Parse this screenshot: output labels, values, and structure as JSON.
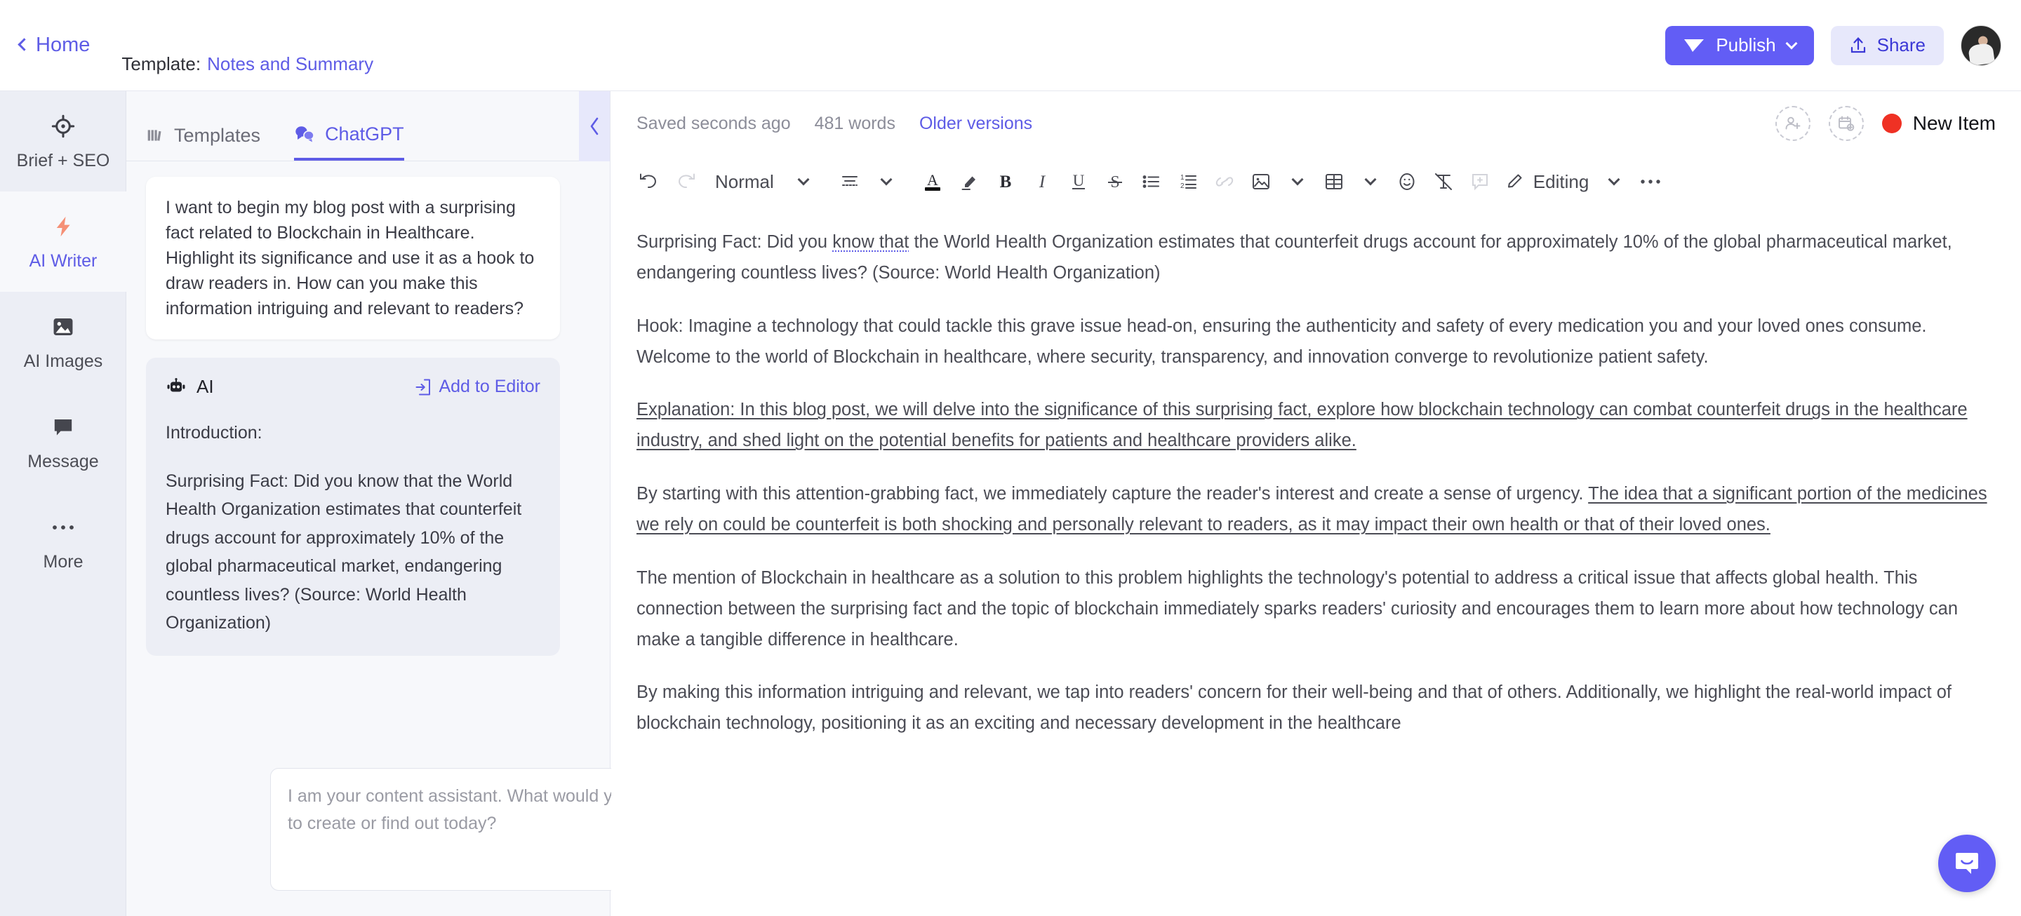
{
  "topbar": {
    "home_label": "Home",
    "template_prefix": "Template:",
    "template_name": "Notes and Summary",
    "publish_label": "Publish",
    "share_label": "Share",
    "accent_color": "#625df5"
  },
  "rail": {
    "items": [
      {
        "label": "Brief + SEO",
        "icon": "target-icon",
        "active": false
      },
      {
        "label": "AI Writer",
        "icon": "lightning-bolt-icon",
        "active": true
      },
      {
        "label": "AI Images",
        "icon": "image-icon",
        "active": false
      },
      {
        "label": "Message",
        "icon": "speech-bubble-icon",
        "active": false
      },
      {
        "label": "More",
        "icon": "ellipsis-icon",
        "active": false
      }
    ]
  },
  "panel": {
    "tabs": [
      {
        "label": "Templates",
        "icon": "templates-icon",
        "active": false
      },
      {
        "label": "ChatGPT",
        "icon": "chat-bubbles-icon",
        "active": true
      }
    ],
    "collapse_icon": "chevron-left-icon",
    "user_message": "I want to begin my blog post with a surprising fact related to Blockchain in Healthcare. Highlight its significance and use it as a hook to draw readers in. How can you make this information intriguing and relevant to readers?",
    "ai_card": {
      "author": "AI",
      "author_icon": "robot-icon",
      "add_to_editor_label": "Add to Editor",
      "add_to_editor_icon": "add-to-document-icon",
      "paragraphs": [
        "Introduction:",
        "Surprising Fact: Did you know that the World Health Organization estimates that counterfeit drugs account for approximately 10% of the global pharmaceutical market, endangering countless lives? (Source: World Health Organization)"
      ]
    },
    "composer_placeholder": "I am your content assistant. What would you like to create or find out today?",
    "send_icon": "send-icon"
  },
  "editor": {
    "saved_status": "Saved seconds ago",
    "word_count": "481 words",
    "older_versions_label": "Older versions",
    "invite_icon": "add-user-icon",
    "schedule_icon": "add-calendar-icon",
    "status_label": "New Item",
    "status_color": "#ef3124",
    "toolbar": {
      "undo_icon": "undo-icon",
      "redo_icon": "redo-icon",
      "style_label": "Normal",
      "style_chevron_icon": "chevron-down-icon",
      "align_icon": "align-left-icon",
      "align_chevron_icon": "chevron-down-icon",
      "text_color_icon": "text-color-icon",
      "highlight_icon": "highlighter-icon",
      "bold_icon": "bold-icon",
      "italic_icon": "italic-icon",
      "underline_icon": "underline-icon",
      "strikethrough_icon": "strikethrough-icon",
      "bullet_list_icon": "bullet-list-icon",
      "numbered_list_icon": "numbered-list-icon",
      "link_icon": "link-icon",
      "image_icon": "image-icon",
      "image_chevron_icon": "chevron-down-icon",
      "table_icon": "table-icon",
      "table_chevron_icon": "chevron-down-icon",
      "emoji_icon": "emoji-icon",
      "clear_format_icon": "clear-formatting-icon",
      "comment_icon": "add-comment-icon",
      "editing_mode_icon": "pencil-icon",
      "editing_mode_label": "Editing",
      "editing_chevron_icon": "chevron-down-icon",
      "more_icon": "ellipsis-icon"
    },
    "document": {
      "paragraphs": [
        {
          "id": "p-surprising-fact",
          "style": "plain",
          "runs": [
            {
              "text": "Surprising Fact: Did you ",
              "mark": "none"
            },
            {
              "text": "know that",
              "mark": "spellcheck"
            },
            {
              "text": " the World Health Organization estimates that counterfeit drugs account for approximately 10% of the global pharmaceutical market, endangering countless lives? (Source: World Health Organization)",
              "mark": "none"
            }
          ]
        },
        {
          "id": "p-hook",
          "style": "plain",
          "runs": [
            {
              "text": "Hook: Imagine a technology that could tackle this grave issue head-on, ensuring the authenticity and safety of every medication you and your loved ones consume. Welcome to the world of Blockchain in healthcare, where security, transparency, and innovation converge to revolutionize patient safety.",
              "mark": "none"
            }
          ]
        },
        {
          "id": "p-explanation",
          "style": "plain",
          "runs": [
            {
              "text": "Explanation: In this blog post, we will delve into the significance of this surprising fact, explore how blockchain technology can combat counterfeit drugs in the healthcare industry, and shed light on the potential benefits for patients and healthcare providers alike.",
              "mark": "tracked-insert"
            }
          ]
        },
        {
          "id": "p-attention-grabbing",
          "style": "plain",
          "runs": [
            {
              "text": "By starting with this attention-grabbing fact, we immediately capture the reader's interest and create a sense of urgency. ",
              "mark": "none"
            },
            {
              "text": "The idea that a significant portion of the medicines we rely on could be counterfeit is both shocking and personally relevant to readers, as it may impact their own health or that of their loved ones.",
              "mark": "tracked-insert"
            }
          ]
        },
        {
          "id": "p-mention",
          "style": "plain",
          "runs": [
            {
              "text": "The mention of Blockchain in healthcare as a solution to this problem highlights the technology's potential to address a critical issue that affects global health. This connection between the surprising fact and the topic of blockchain immediately sparks readers' curiosity and encourages them to learn more about how technology can make a tangible difference in healthcare.",
              "mark": "none"
            }
          ]
        },
        {
          "id": "p-making-intriguing",
          "style": "plain",
          "runs": [
            {
              "text": "By making this information intriguing and relevant, we tap into readers' concern for their well-being and that of others. Additionally, we highlight the real-world impact of blockchain technology, positioning it as an exciting and necessary development in the healthcare",
              "mark": "none"
            }
          ]
        }
      ]
    }
  },
  "support": {
    "intercom_icon": "intercom-chat-icon"
  }
}
